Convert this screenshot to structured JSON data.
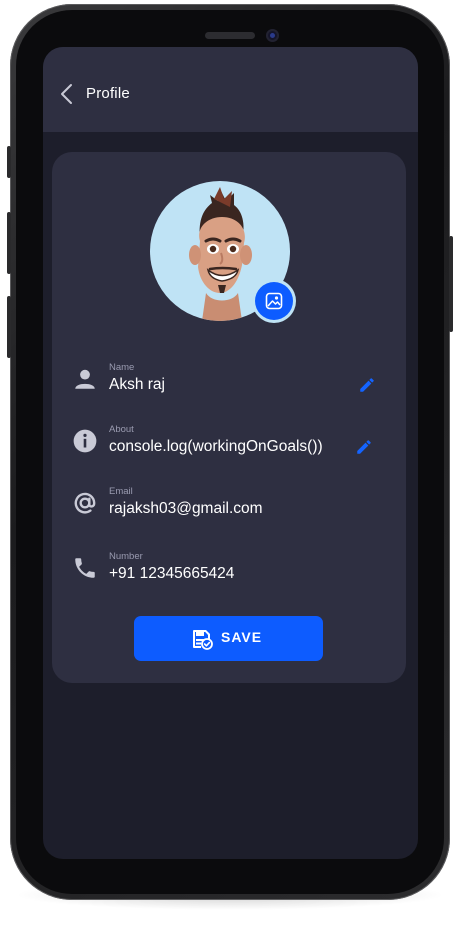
{
  "header": {
    "title": "Profile"
  },
  "profile": {
    "fields": [
      {
        "label": "Name",
        "value": "Aksh raj",
        "icon": "person-icon",
        "editable": true
      },
      {
        "label": "About",
        "value": "console.log(workingOnGoals())",
        "icon": "info-icon",
        "editable": true
      },
      {
        "label": "Email",
        "value": "rajaksh03@gmail.com",
        "icon": "at-icon",
        "editable": false
      },
      {
        "label": "Number",
        "value": "+91 12345665424",
        "icon": "phone-icon",
        "editable": false
      }
    ]
  },
  "actions": {
    "save_label": "SAVE"
  },
  "colors": {
    "background": "#1d1e2b",
    "surface": "#2e2f41",
    "accent": "#0d5cff",
    "avatar_bg": "#bfe3f5",
    "muted_text": "#9a9bb0"
  }
}
